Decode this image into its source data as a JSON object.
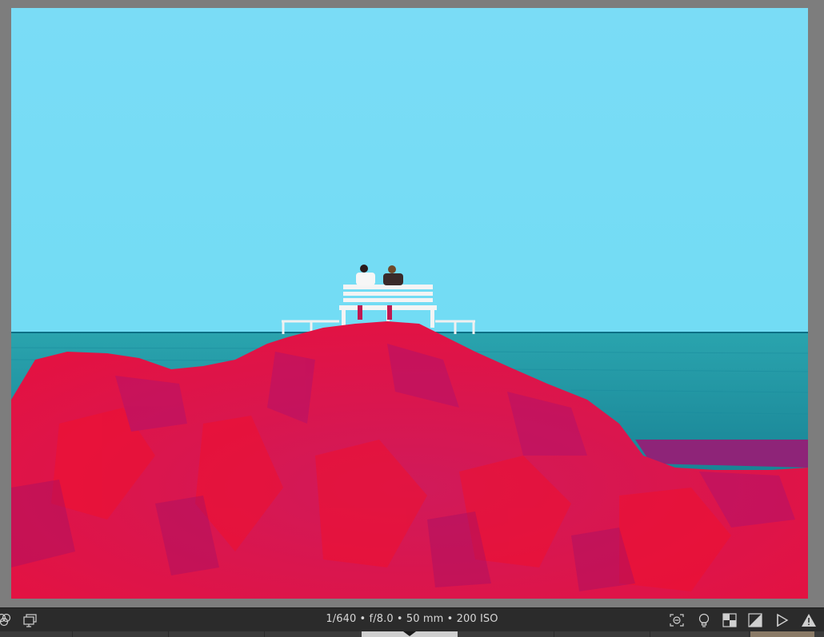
{
  "photo": {
    "description_colors": {
      "sky": "#74dcf4",
      "sea": "#1c9aa6",
      "rock_primary": "#e0144a",
      "rock_secondary": "#c0105e",
      "bench": "#f2f2f2"
    }
  },
  "toolbar": {
    "exif_text": "1/640 • f/8.0 • 50 mm • 200 ISO",
    "left_icons": [
      "color-channels-icon",
      "compare-monitor-icon"
    ],
    "right_icons": [
      "focus-mask-icon",
      "lightbulb-icon",
      "checkerboard-icon",
      "exposure-icon",
      "flag-play-icon",
      "warning-icon"
    ]
  },
  "filmstrip": {
    "active_thumbnail": true
  }
}
